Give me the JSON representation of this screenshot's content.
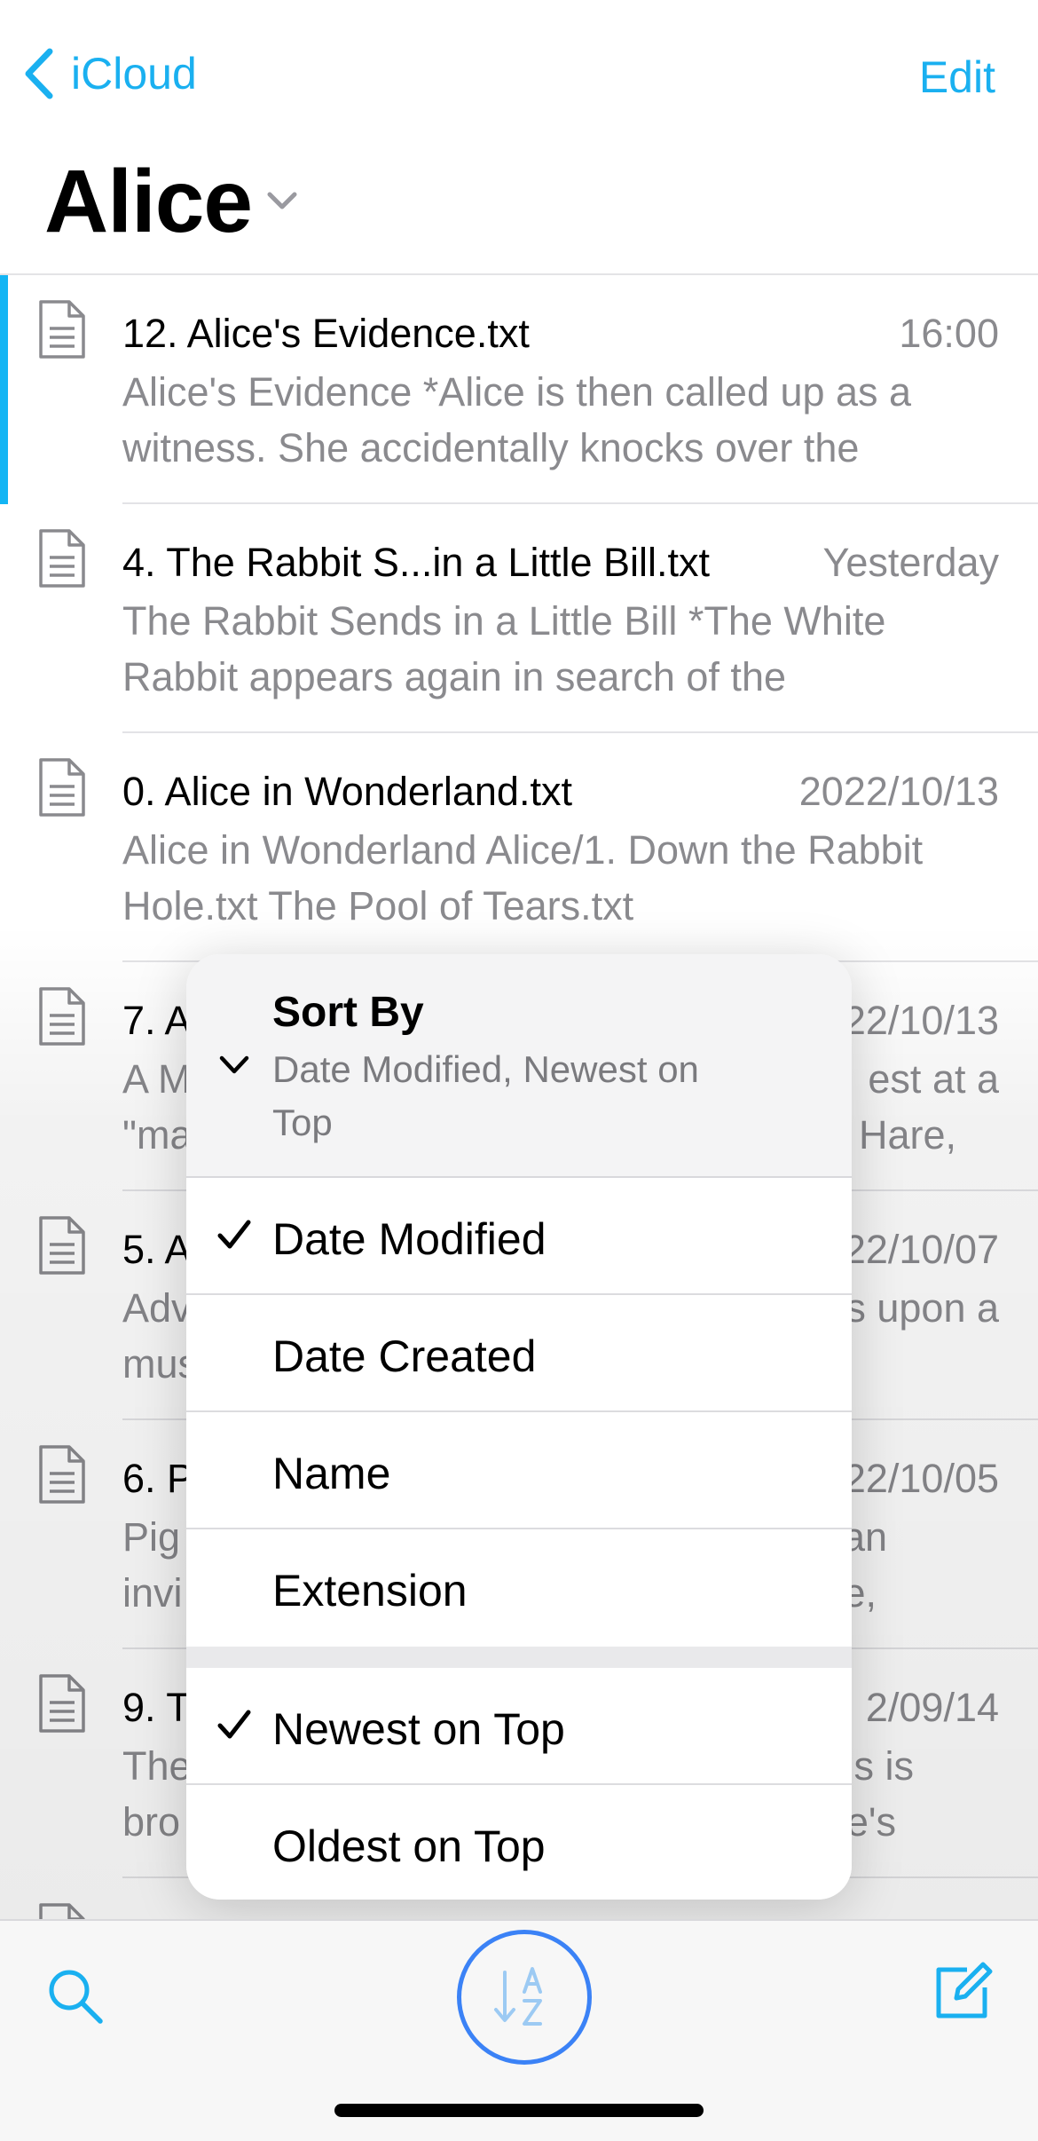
{
  "nav": {
    "back_label": "iCloud",
    "edit_label": "Edit"
  },
  "folder": {
    "title": "Alice"
  },
  "files": [
    {
      "name": "12. Alice's Evidence.txt",
      "date": "16:00",
      "preview": "Alice's Evidence *Alice is then called up as a witness. She accidentally knocks over the"
    },
    {
      "name": "4. The Rabbit S...in a Little Bill.txt",
      "date": "Yesterday",
      "preview": "The Rabbit Sends in a Little Bill *The White Rabbit appears again in search of the"
    },
    {
      "name": "0. Alice in Wonderland.txt",
      "date": "2022/10/13",
      "preview": "Alice in Wonderland Alice/1. Down the Rabbit Hole.txt The Pool of Tears.txt"
    },
    {
      "name": "7. A",
      "date": "22/10/13",
      "preview_left": "A M",
      "preview_left2": "\"ma",
      "preview_right": "est at a",
      "preview_right2": "Hare,"
    },
    {
      "name": "5. A",
      "date": "22/10/07",
      "preview_left": "Adv",
      "preview_left2": "mus",
      "preview_right": "s upon a",
      "preview_right2": ""
    },
    {
      "name": "6. P",
      "date": "22/10/05",
      "preview_left": "Pig",
      "preview_left2": "invi",
      "preview_right": "an",
      "preview_right2": "e,"
    },
    {
      "name": "9. T",
      "date": "2/09/14",
      "preview_left": "The",
      "preview_left2": "bro",
      "preview_right": "s is",
      "preview_right2": "e's"
    }
  ],
  "sort_menu": {
    "title": "Sort By",
    "subtitle": "Date Modified, Newest on Top",
    "fields": [
      {
        "label": "Date Modified",
        "checked": true
      },
      {
        "label": "Date Created",
        "checked": false
      },
      {
        "label": "Name",
        "checked": false
      },
      {
        "label": "Extension",
        "checked": false
      }
    ],
    "orders": [
      {
        "label": "Newest on Top",
        "checked": true
      },
      {
        "label": "Oldest on Top",
        "checked": false
      }
    ]
  },
  "colors": {
    "accent": "#1ab0f0",
    "selection_bar": "#13b5f4",
    "sort_ring": "#3b82f6"
  },
  "icons": {
    "back": "chevron-left-icon",
    "title_dropdown": "chevron-down-icon",
    "file": "document-icon",
    "search": "search-icon",
    "sort": "sort-az-icon",
    "compose": "compose-icon",
    "check": "checkmark-icon"
  }
}
